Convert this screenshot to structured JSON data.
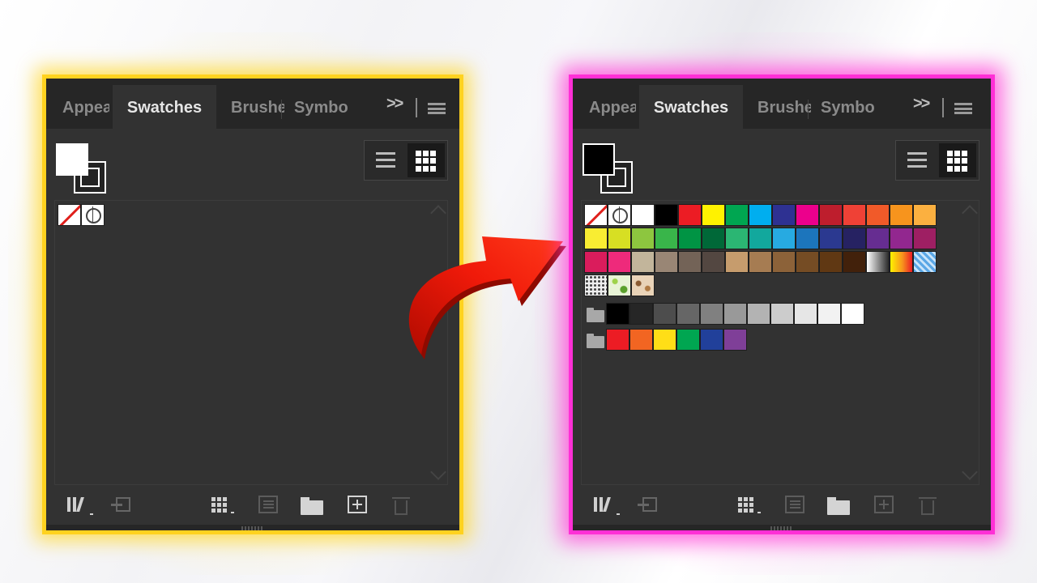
{
  "colors": {
    "yellow_frame": "#ffd21f",
    "pink_frame": "#ff2fd6",
    "arrow": "#f01a0a"
  },
  "panels": [
    {
      "id": "before",
      "tabs": [
        "Appearance",
        "Swatches",
        "Brushes",
        "Symbols"
      ],
      "active_tab": "Swatches",
      "collapse_label": ">>",
      "fill": "white",
      "stroke": "black",
      "view": "grid",
      "swatch_rows": [
        [
          "none",
          "registration"
        ]
      ]
    },
    {
      "id": "after",
      "tabs": [
        "Appearance",
        "Swatches",
        "Brushes",
        "Symbols"
      ],
      "active_tab": "Swatches",
      "collapse_label": ">>",
      "fill": "black",
      "stroke": "black",
      "view": "grid",
      "swatch_rows": [
        [
          "none",
          "registration",
          "#ffffff",
          "#000000",
          "#ec1c24",
          "#fff200",
          "#00a651",
          "#00aeef",
          "#2e3192",
          "#ec008c",
          "#be1e2d",
          "#ef4136",
          "#f15a29",
          "#f7941d",
          "#fbb040"
        ],
        [
          "#f9ed32",
          "#d7df23",
          "#8dc63f",
          "#39b54a",
          "#009444",
          "#006838",
          "#2bb673",
          "#12a89d",
          "#27aae1",
          "#1c75bc",
          "#2b3990",
          "#262262",
          "#662d91",
          "#92278f",
          "#9e1f63"
        ],
        [
          "#da1c5c",
          "#ee2a7b",
          "#c2b59b",
          "#998675",
          "#736357",
          "#534741",
          "#c69c6d",
          "#a67c52",
          "#8c6239",
          "#754c24",
          "#603813",
          "#42210b",
          "gradient-grey",
          "gradient-orange",
          "pattern-blue"
        ],
        [
          "pattern-dots",
          "pattern-leaf",
          "pattern-floral"
        ]
      ],
      "groups": [
        [
          "#000000",
          "#262626",
          "#4d4d4d",
          "#666666",
          "#808080",
          "#999999",
          "#b3b3b3",
          "#cccccc",
          "#e6e6e6",
          "#f2f2f2",
          "#ffffff"
        ],
        [
          "#ec1c24",
          "#f26522",
          "#ffde17",
          "#00a651",
          "#21409a",
          "#7f3f98"
        ]
      ]
    }
  ],
  "tab_labels": {
    "appearance": "Appea",
    "swatches": "Swatches",
    "brushes": "Brushe",
    "symbols": "Symbo"
  },
  "collapse": ">>"
}
